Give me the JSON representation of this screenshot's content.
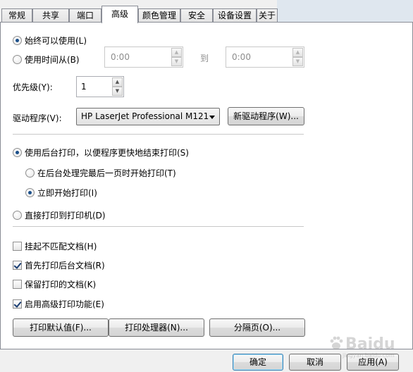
{
  "tabs": [
    {
      "label": "常规",
      "active": false
    },
    {
      "label": "共享",
      "active": false
    },
    {
      "label": "端口",
      "active": false
    },
    {
      "label": "高级",
      "active": true
    },
    {
      "label": "颜色管理",
      "active": false
    },
    {
      "label": "安全",
      "active": false
    },
    {
      "label": "设备设置",
      "active": false
    },
    {
      "label": "关于",
      "active": false
    }
  ],
  "availability": {
    "always_label": "始终可以使用(L)",
    "always_checked": true,
    "from_label": "使用时间从(B)",
    "from_checked": false,
    "from_value": "0:00",
    "to_label": "到",
    "to_value": "0:00"
  },
  "priority": {
    "label": "优先级(Y):",
    "value": "1"
  },
  "driver": {
    "label": "驱动程序(V):",
    "selected": "HP LaserJet Professional M121",
    "new_driver_button": "新驱动程序(W)..."
  },
  "spool": {
    "spool_label": "使用后台打印，以便程序更快地结束打印(S)",
    "spool_checked": true,
    "after_last_page_label": "在后台处理完最后一页时开始打印(T)",
    "after_last_page_checked": false,
    "immediately_label": "立即开始打印(I)",
    "immediately_checked": true,
    "direct_label": "直接打印到打印机(D)",
    "direct_checked": false
  },
  "options": {
    "hold_mismatched_label": "挂起不匹配文档(H)",
    "hold_mismatched_checked": false,
    "spooled_first_label": "首先打印后台文档(R)",
    "spooled_first_checked": true,
    "keep_printed_label": "保留打印的文档(K)",
    "keep_printed_checked": false,
    "advanced_features_label": "启用高级打印功能(E)",
    "advanced_features_checked": true
  },
  "panel_buttons": {
    "defaults": "打印默认值(F)...",
    "processor": "打印处理器(N)...",
    "separator_page": "分隔页(O)..."
  },
  "dialog_buttons": {
    "ok": "确定",
    "cancel": "取消",
    "apply": "应用(A)"
  },
  "watermark": {
    "brand": "Baidu",
    "sub": "jingyan.baidu.com"
  },
  "colors": {
    "tab_border": "#898c95",
    "accent_dot": "#1a4f8a",
    "default_button_border": "#3c7fb1"
  }
}
